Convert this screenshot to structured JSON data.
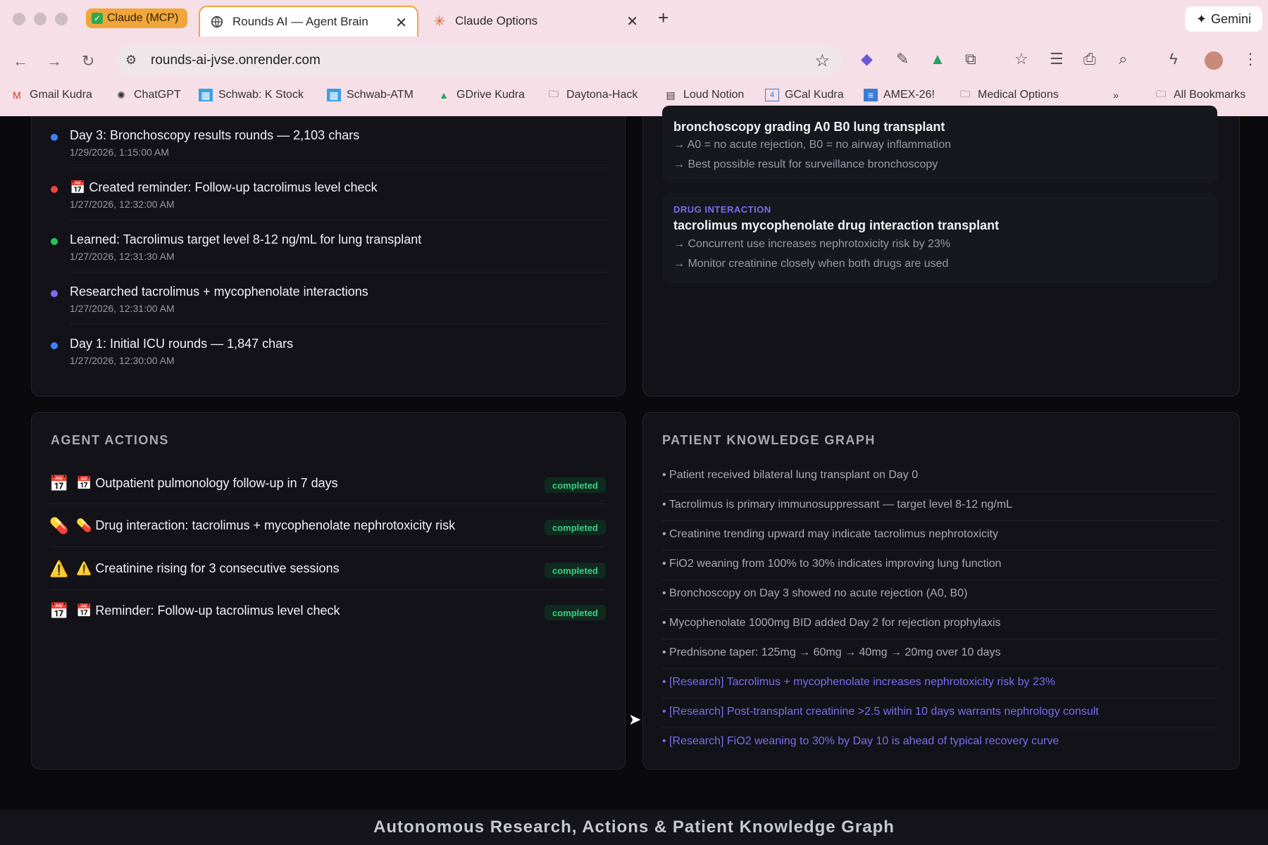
{
  "browser": {
    "tabs": [
      {
        "label": "Claude (MCP)"
      },
      {
        "label": "Rounds AI — Agent Brain"
      },
      {
        "label": "Claude Options"
      }
    ],
    "gemini_label": "Gemini",
    "url": "rounds-ai-jvse.onrender.com",
    "bookmarks": [
      "Gmail Kudra",
      "ChatGPT",
      "Schwab: K Stock",
      "Schwab-ATM",
      "GDrive Kudra",
      "Daytona-Hack",
      "Loud Notion",
      "GCal Kudra",
      "AMEX-26!",
      "Medical Options"
    ],
    "all_bookmarks": "All Bookmarks"
  },
  "timeline": [
    {
      "title": "Day 3: Bronchoscopy results rounds — 2,103 chars",
      "time": "1/29/2026, 1:15:00 AM",
      "color": "#3b82f6"
    },
    {
      "title": "📅 Created reminder: Follow-up tacrolimus level check",
      "time": "1/27/2026, 12:32:00 AM",
      "color": "#ef4444"
    },
    {
      "title": "Learned: Tacrolimus target level 8-12 ng/mL for lung transplant",
      "time": "1/27/2026, 12:31:30 AM",
      "color": "#22c55e"
    },
    {
      "title": "Researched tacrolimus + mycophenolate interactions",
      "time": "1/27/2026, 12:31:00 AM",
      "color": "#7c6cf0"
    },
    {
      "title": "Day 1: Initial ICU rounds — 1,847 chars",
      "time": "1/27/2026, 12:30:00 AM",
      "color": "#3b82f6"
    }
  ],
  "research": [
    {
      "category": "",
      "query": "bronchoscopy grading A0 B0 lung transplant",
      "findings": [
        "→ A0 = no acute rejection, B0 = no airway inflammation",
        "→ Best possible result for surveillance bronchoscopy"
      ]
    },
    {
      "category": "DRUG INTERACTION",
      "query": "tacrolimus mycophenolate drug interaction transplant",
      "findings": [
        "→ Concurrent use increases nephrotoxicity risk by 23%",
        "→ Monitor creatinine closely when both drugs are used"
      ]
    }
  ],
  "actions": {
    "title": "AGENT ACTIONS",
    "items": [
      {
        "icon": "📅",
        "label": "📅 Outpatient pulmonology follow-up in 7 days",
        "status": "completed"
      },
      {
        "icon": "💊",
        "label": "💊 Drug interaction: tacrolimus + mycophenolate nephrotoxicity risk",
        "status": "completed"
      },
      {
        "icon": "⚠️",
        "label": "⚠️ Creatinine rising for 3 consecutive sessions",
        "status": "completed"
      },
      {
        "icon": "📅",
        "label": "📅 Reminder: Follow-up tacrolimus level check",
        "status": "completed"
      }
    ]
  },
  "knowledge": {
    "title": "PATIENT KNOWLEDGE GRAPH",
    "facts": [
      {
        "text": "• Patient received bilateral lung transplant on Day 0",
        "research": false
      },
      {
        "text": "• Tacrolimus is primary immunosuppressant — target level 8-12 ng/mL",
        "research": false
      },
      {
        "text": "• Creatinine trending upward may indicate tacrolimus nephrotoxicity",
        "research": false
      },
      {
        "text": "• FiO2 weaning from 100% to 30% indicates improving lung function",
        "research": false
      },
      {
        "text": "• Bronchoscopy on Day 3 showed no acute rejection (A0, B0)",
        "research": false
      },
      {
        "text": "• Mycophenolate 1000mg BID added Day 2 for rejection prophylaxis",
        "research": false
      },
      {
        "text": "• Prednisone taper: 125mg → 60mg → 40mg → 20mg over 10 days",
        "research": false
      },
      {
        "text": "• [Research] Tacrolimus + mycophenolate increases nephrotoxicity risk by 23%",
        "research": true
      },
      {
        "text": "• [Research] Post-transplant creatinine >2.5 within 10 days warrants nephrology consult",
        "research": true
      },
      {
        "text": "• [Research] FiO2 weaning to 30% by Day 10 is ahead of typical recovery curve",
        "research": true
      }
    ]
  },
  "caption": "Autonomous Research, Actions & Patient Knowledge Graph"
}
